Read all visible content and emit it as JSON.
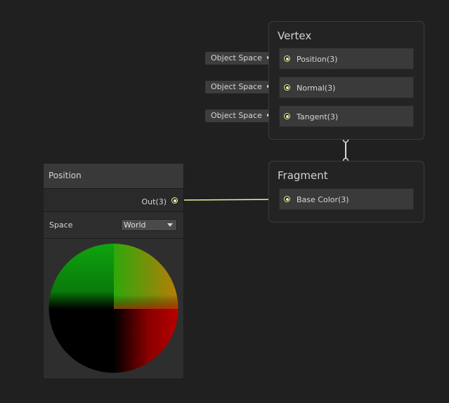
{
  "vertex_context": {
    "title": "Vertex",
    "blocks": [
      {
        "label": "Position(3)",
        "default_space": "Object Space"
      },
      {
        "label": "Normal(3)",
        "default_space": "Object Space"
      },
      {
        "label": "Tangent(3)",
        "default_space": "Object Space"
      }
    ]
  },
  "fragment_context": {
    "title": "Fragment",
    "blocks": [
      {
        "label": "Base Color(3)"
      }
    ]
  },
  "position_node": {
    "title": "Position",
    "output_label": "Out(3)",
    "setting_label": "Space",
    "space_value": "World",
    "preview": "sphere-preview"
  },
  "colors": {
    "canvas_bg": "#202020",
    "port_color": "#f0f0a0",
    "wire_color": "#f0f0a0",
    "flow_wire_color": "#d8d8d8"
  },
  "icons": {
    "port": "circle-port-icon",
    "dropdown_arrow": "chevron-down-icon"
  }
}
